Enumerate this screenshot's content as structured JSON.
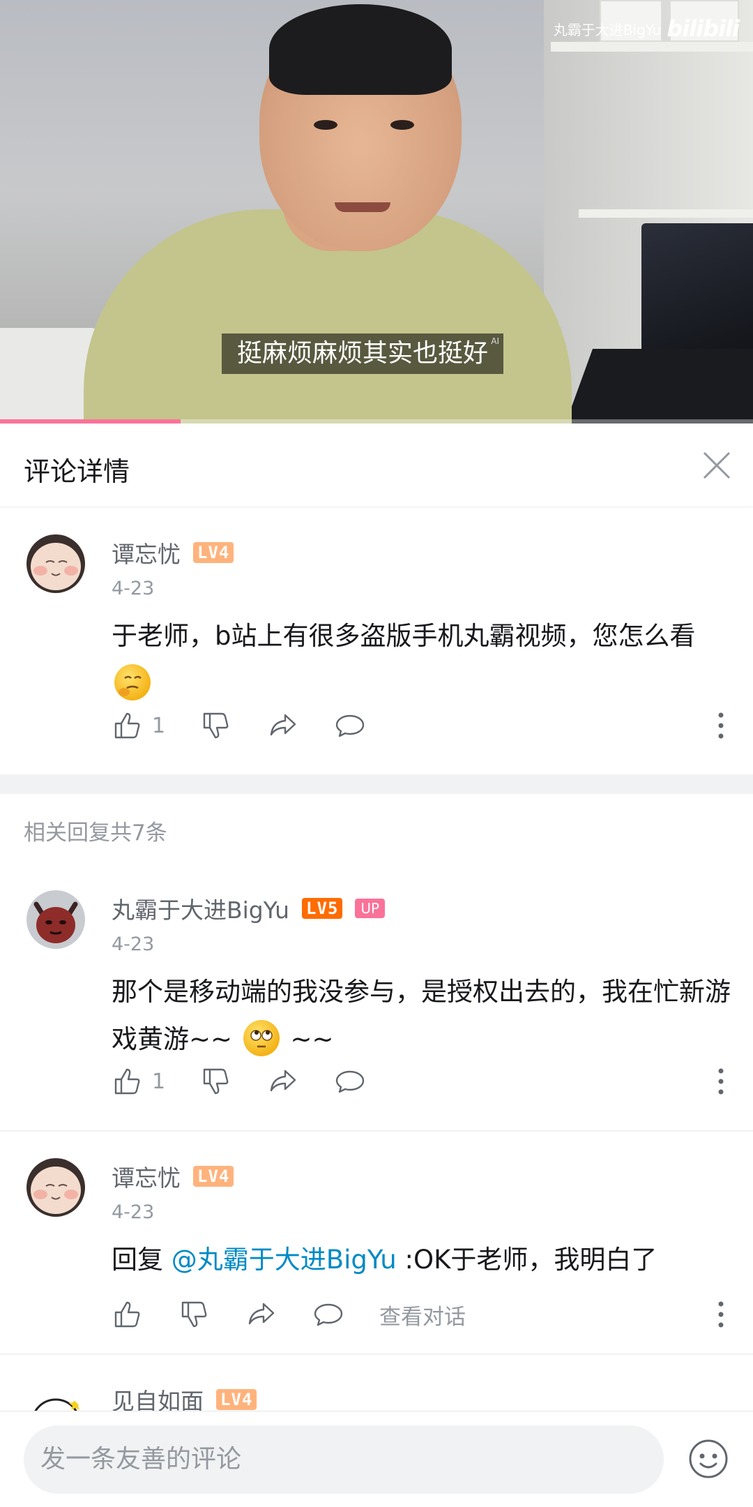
{
  "video": {
    "subtitle": "挺麻烦麻烦其实也挺好",
    "subtitle_ai_tag": "AI",
    "watermark_uploader": "丸霸于大进BigYu",
    "watermark_logo": "bilibili",
    "progress_fraction": 0.24
  },
  "panel": {
    "title": "评论详情"
  },
  "main_comment": {
    "username": "谭忘忧",
    "level": "LV4",
    "date": "4-23",
    "text": "于老师，b站上有很多盗版手机丸霸视频，您怎么看",
    "emoji": "thinking-face",
    "like_count": "1"
  },
  "replies_header": "相关回复共7条",
  "replies": [
    {
      "username": "丸霸于大进BigYu",
      "level": "LV5",
      "badge": "UP",
      "date": "4-23",
      "text_a": "那个是移动端的我没参与，是授权出去的，我在忙新游戏黄游~~",
      "text_b": "~~",
      "like_count": "1"
    },
    {
      "username": "谭忘忧",
      "level": "LV4",
      "date": "4-23",
      "prefix": "回复 ",
      "mention": "@丸霸于大进BigYu",
      "text": " :OK于老师，我明白了",
      "view_conversation": "查看对话"
    },
    {
      "username": "见自如面",
      "level": "LV4"
    }
  ],
  "input": {
    "placeholder": "发一条友善的评论"
  },
  "colors": {
    "accent_pink": "#fb7299",
    "link_blue": "#008ac5",
    "lv4": "#ffb37c",
    "lv5": "#ff6c00"
  }
}
